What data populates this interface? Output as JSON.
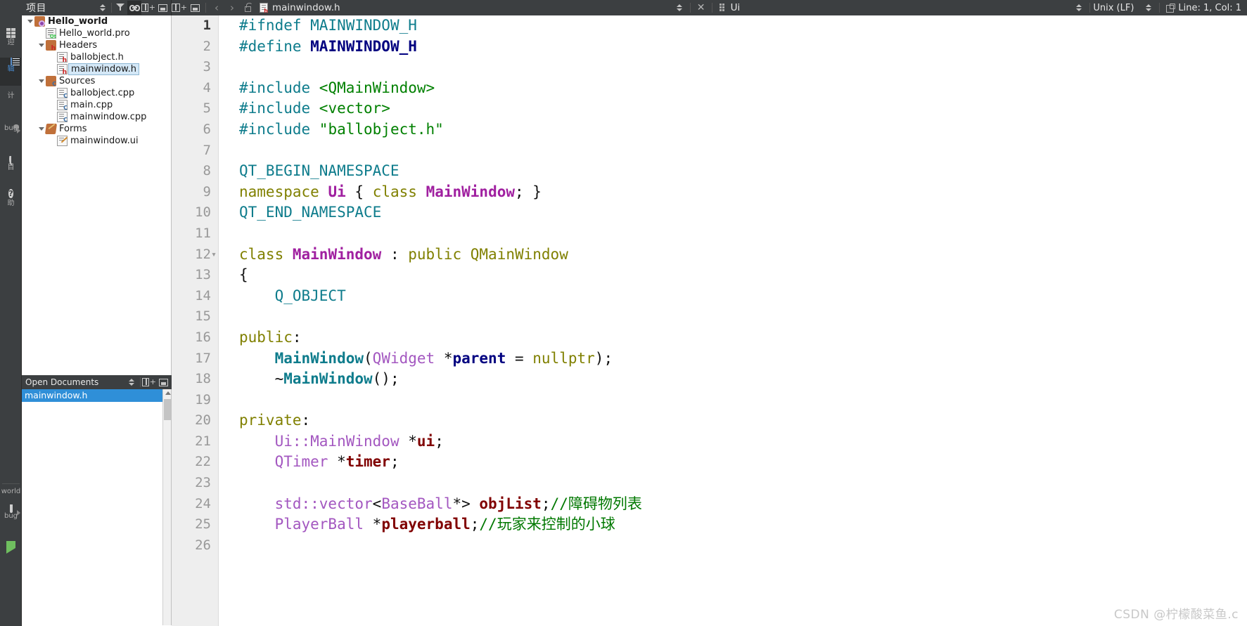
{
  "mode_rail": {
    "items": [
      {
        "name": "welcome",
        "label": "迎",
        "icon": "grid-icon",
        "active": false
      },
      {
        "name": "edit",
        "label": "辑",
        "icon": "edit-icon",
        "active": true
      },
      {
        "name": "design",
        "label": "计",
        "icon": "design-icon",
        "active": false
      },
      {
        "name": "debug",
        "label": "bug",
        "icon": "debug-icon",
        "active": false
      },
      {
        "name": "projects",
        "label": "目",
        "icon": "wrench-icon",
        "active": false
      },
      {
        "name": "help",
        "label": "助",
        "icon": "help-icon",
        "active": false
      }
    ],
    "bottom": {
      "kit_label": "world",
      "run_config_label": "bug"
    }
  },
  "project_panel": {
    "title": "项目",
    "toolbar": [
      {
        "name": "sync-selector",
        "icon": "up-down-icon"
      },
      {
        "name": "filter",
        "icon": "filter-icon"
      },
      {
        "name": "link-with-editor",
        "icon": "link-icon",
        "pressed": true
      },
      {
        "name": "add-split",
        "icon": "split-plus-icon"
      },
      {
        "name": "close-panel",
        "icon": "close-panel-icon"
      }
    ],
    "tree": [
      {
        "label": "Hello_world",
        "indent": 0,
        "icon": "project-icon",
        "expanded": true,
        "bold": true,
        "selected": false
      },
      {
        "label": "Hello_world.pro",
        "indent": 1,
        "icon": "qt-pro-file-icon",
        "expanded": null,
        "bold": false,
        "selected": false
      },
      {
        "label": "Headers",
        "indent": 1,
        "icon": "headers-folder-icon",
        "expanded": true,
        "bold": false,
        "selected": false
      },
      {
        "label": "ballobject.h",
        "indent": 2,
        "icon": "header-file-icon",
        "expanded": null,
        "bold": false,
        "selected": false
      },
      {
        "label": "mainwindow.h",
        "indent": 2,
        "icon": "header-file-icon",
        "expanded": null,
        "bold": false,
        "selected": true
      },
      {
        "label": "Sources",
        "indent": 1,
        "icon": "sources-folder-icon",
        "expanded": true,
        "bold": false,
        "selected": false
      },
      {
        "label": "ballobject.cpp",
        "indent": 2,
        "icon": "cpp-file-icon",
        "expanded": null,
        "bold": false,
        "selected": false
      },
      {
        "label": "main.cpp",
        "indent": 2,
        "icon": "cpp-file-icon",
        "expanded": null,
        "bold": false,
        "selected": false
      },
      {
        "label": "mainwindow.cpp",
        "indent": 2,
        "icon": "cpp-file-icon",
        "expanded": null,
        "bold": false,
        "selected": false
      },
      {
        "label": "Forms",
        "indent": 1,
        "icon": "forms-folder-icon",
        "expanded": true,
        "bold": false,
        "selected": false
      },
      {
        "label": "mainwindow.ui",
        "indent": 2,
        "icon": "ui-file-icon",
        "expanded": null,
        "bold": false,
        "selected": false
      }
    ]
  },
  "open_documents": {
    "title": "Open Documents",
    "items": [
      {
        "label": "mainwindow.h",
        "selected": true
      }
    ]
  },
  "editor_bar": {
    "back_glyph": "‹",
    "forward_glyph": "›",
    "filename": "mainwindow.h",
    "close_glyph": "✕",
    "ui_label": "Ui",
    "line_ending": "Unix (LF)",
    "cursor_position": "Line: 1, Col: 1"
  },
  "editor": {
    "lines": [
      {
        "num": 1,
        "fold": false,
        "current": true,
        "tokens": [
          {
            "t": "#ifndef ",
            "c": "pp"
          },
          {
            "t": "MAINWINDOW_H",
            "c": "pp"
          }
        ]
      },
      {
        "num": 2,
        "fold": false,
        "current": false,
        "tokens": [
          {
            "t": "#define ",
            "c": "pp"
          },
          {
            "t": "MAINWINDOW_H",
            "c": "ppb"
          }
        ]
      },
      {
        "num": 3,
        "fold": false,
        "current": false,
        "tokens": []
      },
      {
        "num": 4,
        "fold": false,
        "current": false,
        "tokens": [
          {
            "t": "#include ",
            "c": "pp"
          },
          {
            "t": "<QMainWindow>",
            "c": "inc"
          }
        ]
      },
      {
        "num": 5,
        "fold": false,
        "current": false,
        "tokens": [
          {
            "t": "#include ",
            "c": "pp"
          },
          {
            "t": "<vector>",
            "c": "inc"
          }
        ]
      },
      {
        "num": 6,
        "fold": false,
        "current": false,
        "tokens": [
          {
            "t": "#include ",
            "c": "pp"
          },
          {
            "t": "\"ballobject.h\"",
            "c": "inc"
          }
        ]
      },
      {
        "num": 7,
        "fold": false,
        "current": false,
        "tokens": []
      },
      {
        "num": 8,
        "fold": false,
        "current": false,
        "tokens": [
          {
            "t": "QT_BEGIN_NAMESPACE",
            "c": "qtm"
          }
        ]
      },
      {
        "num": 9,
        "fold": false,
        "current": false,
        "tokens": [
          {
            "t": "namespace ",
            "c": "k"
          },
          {
            "t": "Ui",
            "c": "cls"
          },
          {
            "t": " ",
            "c": "op"
          },
          {
            "t": "{",
            "c": "op"
          },
          {
            "t": " ",
            "c": "op"
          },
          {
            "t": "class",
            "c": "k"
          },
          {
            "t": " ",
            "c": "op"
          },
          {
            "t": "MainWindow",
            "c": "cls"
          },
          {
            "t": "; }",
            "c": "op"
          }
        ]
      },
      {
        "num": 10,
        "fold": false,
        "current": false,
        "tokens": [
          {
            "t": "QT_END_NAMESPACE",
            "c": "qtm"
          }
        ]
      },
      {
        "num": 11,
        "fold": false,
        "current": false,
        "tokens": []
      },
      {
        "num": 12,
        "fold": true,
        "current": false,
        "tokens": [
          {
            "t": "class",
            "c": "k"
          },
          {
            "t": " ",
            "c": "op"
          },
          {
            "t": "MainWindow",
            "c": "cls"
          },
          {
            "t": " : ",
            "c": "op"
          },
          {
            "t": "public",
            "c": "k"
          },
          {
            "t": " ",
            "c": "op"
          },
          {
            "t": "QMainWindow",
            "c": "k"
          }
        ]
      },
      {
        "num": 13,
        "fold": false,
        "current": false,
        "tokens": [
          {
            "t": "{",
            "c": "op"
          }
        ]
      },
      {
        "num": 14,
        "fold": false,
        "current": false,
        "tokens": [
          {
            "t": "    ",
            "c": "op"
          },
          {
            "t": "Q_OBJECT",
            "c": "qtm"
          }
        ]
      },
      {
        "num": 15,
        "fold": false,
        "current": false,
        "tokens": []
      },
      {
        "num": 16,
        "fold": false,
        "current": false,
        "tokens": [
          {
            "t": "public",
            "c": "k"
          },
          {
            "t": ":",
            "c": "op"
          }
        ]
      },
      {
        "num": 17,
        "fold": false,
        "current": false,
        "tokens": [
          {
            "t": "    ",
            "c": "op"
          },
          {
            "t": "MainWindow",
            "c": "fn"
          },
          {
            "t": "(",
            "c": "op"
          },
          {
            "t": "QWidget",
            "c": "typ"
          },
          {
            "t": " *",
            "c": "op"
          },
          {
            "t": "parent",
            "c": "var"
          },
          {
            "t": " = ",
            "c": "op"
          },
          {
            "t": "nullptr",
            "c": "k"
          },
          {
            "t": ");",
            "c": "op"
          }
        ]
      },
      {
        "num": 18,
        "fold": false,
        "current": false,
        "tokens": [
          {
            "t": "    ~",
            "c": "op"
          },
          {
            "t": "MainWindow",
            "c": "fn"
          },
          {
            "t": "();",
            "c": "op"
          }
        ]
      },
      {
        "num": 19,
        "fold": false,
        "current": false,
        "tokens": []
      },
      {
        "num": 20,
        "fold": false,
        "current": false,
        "tokens": [
          {
            "t": "private",
            "c": "k"
          },
          {
            "t": ":",
            "c": "op"
          }
        ]
      },
      {
        "num": 21,
        "fold": false,
        "current": false,
        "tokens": [
          {
            "t": "    ",
            "c": "op"
          },
          {
            "t": "Ui::MainWindow",
            "c": "typ"
          },
          {
            "t": " *",
            "c": "op"
          },
          {
            "t": "ui",
            "c": "mem"
          },
          {
            "t": ";",
            "c": "op"
          }
        ]
      },
      {
        "num": 22,
        "fold": false,
        "current": false,
        "tokens": [
          {
            "t": "    ",
            "c": "op"
          },
          {
            "t": "QTimer",
            "c": "typ"
          },
          {
            "t": " *",
            "c": "op"
          },
          {
            "t": "timer",
            "c": "mem"
          },
          {
            "t": ";",
            "c": "op"
          }
        ]
      },
      {
        "num": 23,
        "fold": false,
        "current": false,
        "tokens": []
      },
      {
        "num": 24,
        "fold": false,
        "current": false,
        "tokens": [
          {
            "t": "    ",
            "c": "op"
          },
          {
            "t": "std::vector",
            "c": "typ"
          },
          {
            "t": "<",
            "c": "op"
          },
          {
            "t": "BaseBall",
            "c": "typ"
          },
          {
            "t": "*> ",
            "c": "op"
          },
          {
            "t": "objList",
            "c": "mem"
          },
          {
            "t": ";",
            "c": "op"
          },
          {
            "t": "//障碍物列表",
            "c": "cm"
          }
        ]
      },
      {
        "num": 25,
        "fold": false,
        "current": false,
        "tokens": [
          {
            "t": "    ",
            "c": "op"
          },
          {
            "t": "PlayerBall",
            "c": "typ"
          },
          {
            "t": " *",
            "c": "op"
          },
          {
            "t": "playerball",
            "c": "mem"
          },
          {
            "t": ";",
            "c": "op"
          },
          {
            "t": "//玩家来控制的小球",
            "c": "cm"
          }
        ]
      },
      {
        "num": 26,
        "fold": false,
        "current": false,
        "tokens": []
      }
    ]
  },
  "watermark": {
    "text": "CSDN @柠檬酸菜鱼.c"
  },
  "colors": {
    "chrome_bg": "#3c3f41",
    "editor_bg": "#ffffff",
    "gutter_bg": "#eeeeee",
    "selection_blue": "#2f8fd8",
    "tree_selection": "#d4e8f7",
    "accent_active": "#4a90d9"
  }
}
